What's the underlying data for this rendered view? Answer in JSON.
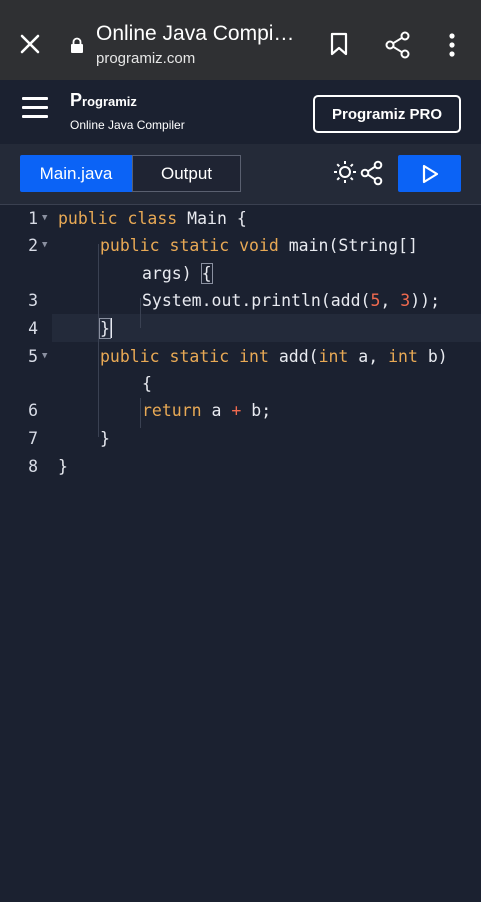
{
  "browser": {
    "title": "Online Java Compi…",
    "url": "programiz.com"
  },
  "header": {
    "logo_mark": "P",
    "logo_text": "rogramiz",
    "subtitle": "Online Java Compiler",
    "pro_label": "Programiz PRO"
  },
  "tabs": {
    "main_label": "Main.java",
    "output_label": "Output"
  },
  "colors": {
    "accent": "#0b63f6",
    "keyword": "#e8a955",
    "number": "#f06a4f"
  },
  "code": {
    "line_numbers": [
      "1",
      "2",
      "3",
      "4",
      "5",
      "6",
      "7",
      "8"
    ],
    "l1_kw": "public class",
    "l1_rest": " Main {",
    "l2_kw": "public static void",
    "l2_rest": " main(String[]",
    "l2b_text": "args) ",
    "l2b_brace": "{",
    "l3_a": "System.out.println(add(",
    "l3_n1": "5",
    "l3_b": ", ",
    "l3_n2": "3",
    "l3_c": "));",
    "l4_brace": "}",
    "l5_kw1": "public static int",
    "l5_a": " add(",
    "l5_kw2": "int",
    "l5_b": " a, ",
    "l5_kw3": "int",
    "l5_c": " b)",
    "l5b": "{",
    "l6_kw": "return",
    "l6_a": " a ",
    "l6_op": "+",
    "l6_b": " b;",
    "l7": "}",
    "l8": "}"
  }
}
